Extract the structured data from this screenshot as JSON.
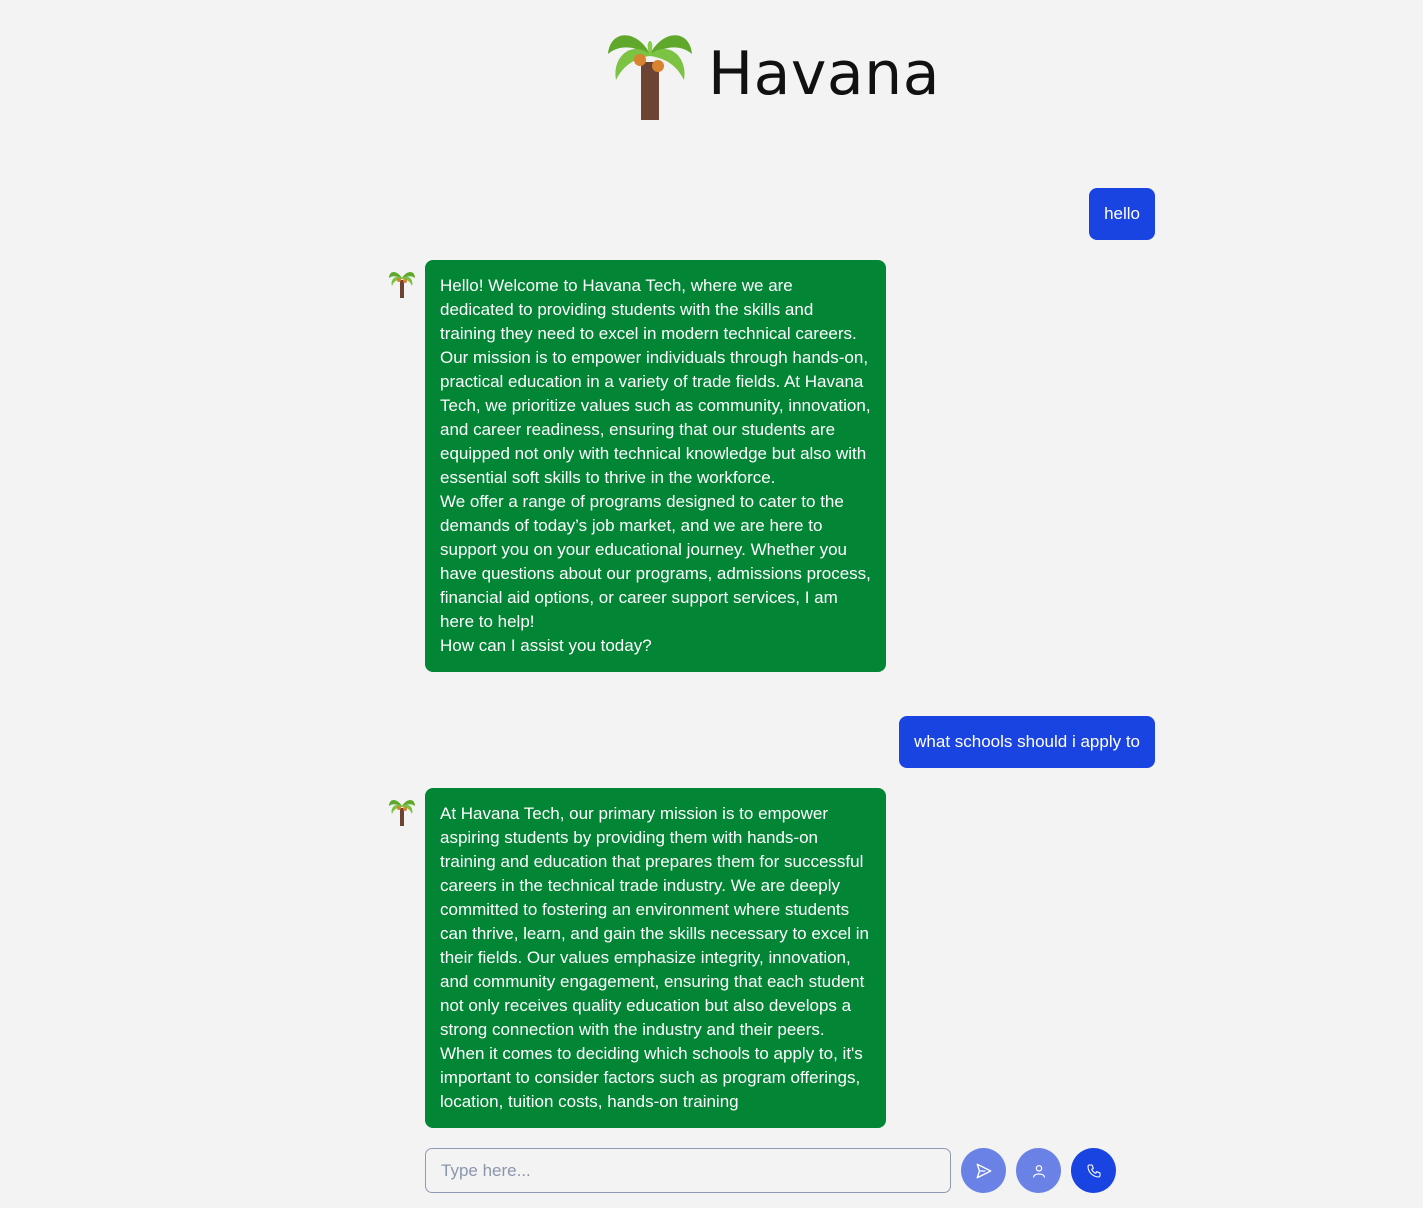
{
  "header": {
    "brand": "Havana",
    "logo_icon": "palm-tree-icon"
  },
  "colors": {
    "background": "#f3f3f3",
    "user_bubble": "#1a44e2",
    "bot_bubble": "#028535",
    "secondary_button": "#6a82e6",
    "primary_button": "#1a44e2"
  },
  "chat": {
    "messages": [
      {
        "role": "user",
        "text": "hello"
      },
      {
        "role": "bot",
        "paragraphs": [
          "Hello! Welcome to Havana Tech, where we are dedicated to providing students with the skills and training they need to excel in modern technical careers. Our mission is to empower individuals through hands-on, practical education in a variety of trade fields. At Havana Tech, we prioritize values such as community, innovation, and career readiness, ensuring that our students are equipped not only with technical knowledge but also with essential soft skills to thrive in the workforce.",
          "We offer a range of programs designed to cater to the demands of today’s job market, and we are here to support you on your educational journey. Whether you have questions about our programs, admissions process, financial aid options, or career support services, I am here to help!",
          "How can I assist you today?"
        ]
      },
      {
        "role": "user",
        "text": "what schools should i apply to"
      },
      {
        "role": "bot",
        "paragraphs": [
          "At Havana Tech, our primary mission is to empower aspiring students by providing them with hands-on training and education that prepares them for successful careers in the technical trade industry. We are deeply committed to fostering an environment where students can thrive, learn, and gain the skills necessary to excel in their fields. Our values emphasize integrity, innovation, and community engagement, ensuring that each student not only receives quality education but also develops a strong connection with the industry and their peers.",
          "When it comes to deciding which schools to apply to, it's important to consider factors such as program offerings, location, tuition costs, hands-on training"
        ]
      }
    ]
  },
  "input": {
    "placeholder": "Type here...",
    "value": ""
  },
  "buttons": {
    "send_icon": "send-icon",
    "user_icon": "user-icon",
    "call_icon": "phone-icon"
  }
}
